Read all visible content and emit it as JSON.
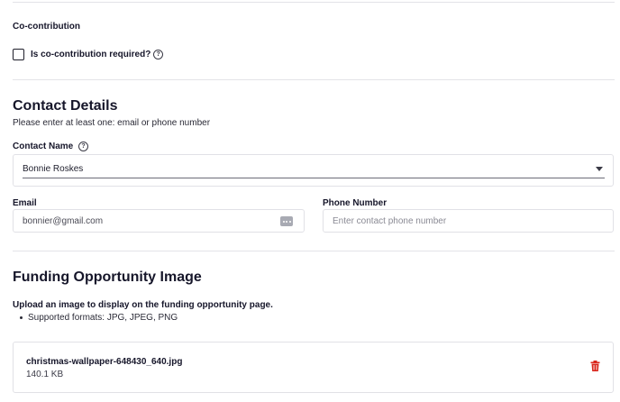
{
  "co_contribution": {
    "title": "Co-contribution",
    "checkbox_label": "Is co-contribution required?",
    "help_icon": "question-circle-icon",
    "checked": false
  },
  "contact": {
    "heading": "Contact Details",
    "subtext": "Please enter at least one: email or phone number",
    "name_label": "Contact Name",
    "name_value": "Bonnie Roskes",
    "email_label": "Email",
    "email_value": "bonnier@gmail.com",
    "phone_label": "Phone Number",
    "phone_placeholder": "Enter contact phone number"
  },
  "image": {
    "heading": "Funding Opportunity Image",
    "instructions": "Upload an image to display on the funding opportunity page.",
    "formats": "Supported formats: JPG, JPEG, PNG",
    "file_name": "christmas-wallpaper-648430_640.jpg",
    "file_size": "140.1 KB",
    "delete_icon": "trash-icon",
    "delete_color": "#d9261c"
  }
}
